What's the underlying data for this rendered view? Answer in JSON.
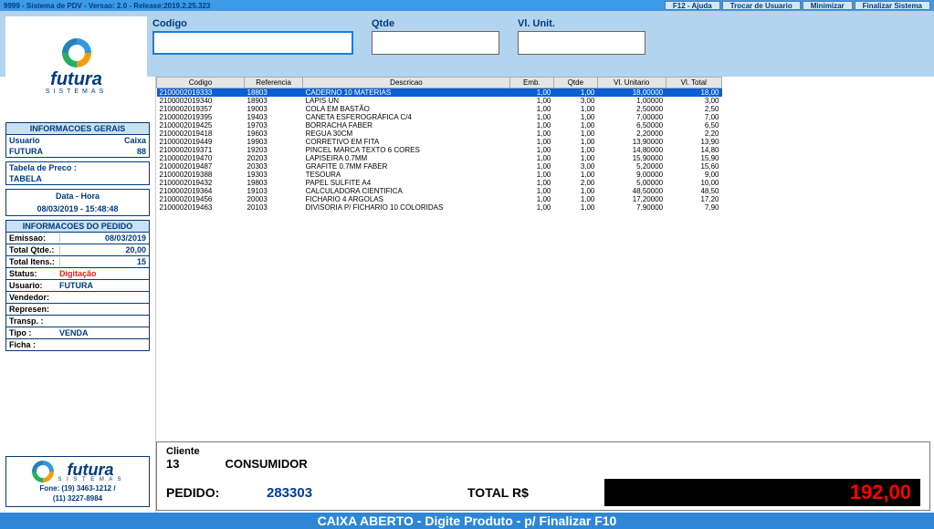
{
  "appTitle": "9999 - Sistema de PDV - Versao: 2.0 - Release:2019.2.25.323",
  "topButtons": {
    "ajuda": "F12 - Ajuda",
    "trocar": "Trocar de Usuario",
    "min": "Minimizar",
    "fin": "Finalizar Sistema"
  },
  "fields": {
    "codigo": "Codigo",
    "qtde": "Qtde",
    "vlunit": "Vl. Unit."
  },
  "logo": {
    "name": "futura",
    "sub": "SISTEMAS"
  },
  "panels": {
    "gerais": {
      "title": "INFORMACOES GERAIS",
      "usuarioLbl": "Usuario",
      "usuario": "FUTURA",
      "caixaLbl": "Caixa",
      "caixa": "88",
      "precoLbl": "Tabela de Preco :",
      "preco": "TABELA",
      "dataHoraLbl": "Data - Hora",
      "dataHora": "08/03/2019 - 15:48:48"
    },
    "pedido": {
      "title": "INFORMACOES DO PEDIDO",
      "rows": [
        {
          "lbl": "Emissao:",
          "val": "08/03/2019",
          "right": true
        },
        {
          "lbl": "Total Qtde.:",
          "val": "20,00",
          "right": true
        },
        {
          "lbl": "Total Itens.:",
          "val": "15",
          "right": true
        },
        {
          "lbl": "Status:",
          "val": "Digitação",
          "red": true
        },
        {
          "lbl": "Usuario:",
          "val": "FUTURA"
        },
        {
          "lbl": "Vendedor:",
          "val": ""
        },
        {
          "lbl": "Represen:",
          "val": ""
        },
        {
          "lbl": "Transp. :",
          "val": ""
        },
        {
          "lbl": "Tipo :",
          "val": "VENDA"
        },
        {
          "lbl": "Ficha :",
          "val": ""
        }
      ]
    }
  },
  "footerLogo": {
    "name": "futura",
    "sub": "S I S T E M A S",
    "phone1": "Fone: (19) 3463-1212 /",
    "phone2": "(11) 3227-8984"
  },
  "grid": {
    "headers": [
      "Codigo",
      "Referencia",
      "Descricao",
      "Emb.",
      "Qtde",
      "Vl. Unitario",
      "Vl. Total"
    ],
    "rows": [
      {
        "sel": true,
        "c": "2100002019333",
        "r": "18803",
        "d": "CADERNO 10 MATERIAS",
        "e": "1,00",
        "q": "1,00",
        "u": "18,00000",
        "t": "18,00"
      },
      {
        "c": "2100002019340",
        "r": "18903",
        "d": "LAPIS UN",
        "e": "1,00",
        "q": "3,00",
        "u": "1,00000",
        "t": "3,00"
      },
      {
        "c": "2100002019357",
        "r": "19003",
        "d": "COLA EM BASTÃO",
        "e": "1,00",
        "q": "1,00",
        "u": "2,50000",
        "t": "2,50"
      },
      {
        "c": "2100002019395",
        "r": "19403",
        "d": "CANETA ESFEROGRÁFICA C/4",
        "e": "1,00",
        "q": "1,00",
        "u": "7,00000",
        "t": "7,00"
      },
      {
        "c": "2100002019425",
        "r": "19703",
        "d": "BORRACHA FABER",
        "e": "1,00",
        "q": "1,00",
        "u": "6,50000",
        "t": "6,50"
      },
      {
        "c": "2100002019418",
        "r": "19603",
        "d": "REGUA 30CM",
        "e": "1,00",
        "q": "1,00",
        "u": "2,20000",
        "t": "2,20"
      },
      {
        "c": "2100002019449",
        "r": "19903",
        "d": "CORRETIVO EM FITA",
        "e": "1,00",
        "q": "1,00",
        "u": "13,90000",
        "t": "13,90"
      },
      {
        "c": "2100002019371",
        "r": "19203",
        "d": "PINCEL MARCA TEXTO 6 CORES",
        "e": "1,00",
        "q": "1,00",
        "u": "14,80000",
        "t": "14,80"
      },
      {
        "c": "2100002019470",
        "r": "20203",
        "d": "LAPISEIRA 0.7MM",
        "e": "1,00",
        "q": "1,00",
        "u": "15,90000",
        "t": "15,90"
      },
      {
        "c": "2100002019487",
        "r": "20303",
        "d": "GRAFITE 0.7MM FABER",
        "e": "1,00",
        "q": "3,00",
        "u": "5,20000",
        "t": "15,60"
      },
      {
        "c": "2100002019388",
        "r": "19303",
        "d": "TESOURA",
        "e": "1,00",
        "q": "1,00",
        "u": "9,00000",
        "t": "9,00"
      },
      {
        "c": "2100002019432",
        "r": "19803",
        "d": "PAPEL SULFITE A4",
        "e": "1,00",
        "q": "2,00",
        "u": "5,00000",
        "t": "10,00"
      },
      {
        "c": "2100002019364",
        "r": "19103",
        "d": "CALCULADORA CIENTIFICA",
        "e": "1,00",
        "q": "1,00",
        "u": "48,50000",
        "t": "48,50"
      },
      {
        "c": "2100002019456",
        "r": "20003",
        "d": "FICHARIO 4 ARGOLAS",
        "e": "1,00",
        "q": "1,00",
        "u": "17,20000",
        "t": "17,20"
      },
      {
        "c": "2100002019463",
        "r": "20103",
        "d": "DIVISORIA P/ FICHARIO 10 COLORIDAS",
        "e": "1,00",
        "q": "1,00",
        "u": "7,90000",
        "t": "7,90"
      }
    ]
  },
  "bottom": {
    "clienteLbl": "Cliente",
    "clienteCod": "13",
    "clienteNome": "CONSUMIDOR",
    "pedidoLbl": "PEDIDO:",
    "pedidoNum": "283303",
    "totalLbl": "TOTAL R$",
    "totalVal": "192,00"
  },
  "statusBar": "CAIXA ABERTO - Digite Produto - p/ Finalizar F10"
}
